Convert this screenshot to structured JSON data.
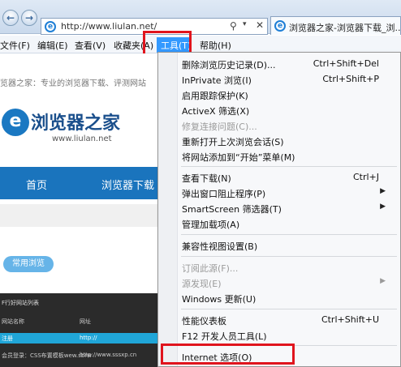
{
  "browser": {
    "address_url": "http://www.liulan.net/",
    "tab_title": "浏览器之家-浏览器下载_浏...",
    "address_icons": [
      "search-icon",
      "dropdown-icon",
      "close-icon"
    ]
  },
  "menubar": {
    "items": [
      "文件(F)",
      "编辑(E)",
      "查看(V)",
      "收藏夹(A)",
      "工具(T)",
      "帮助(H)"
    ],
    "active": "工具(T)"
  },
  "page": {
    "slogan": "览器之家：专业的浏览器下载、评测网站",
    "logo_letter": "e",
    "logo_text": "浏览器之家",
    "logo_domain": "www.liulan.net",
    "nav_home": "首页",
    "nav_download": "浏览器下载",
    "common_label": "常用浏览",
    "table_title": "F行好网站列表",
    "table_headers": [
      "网站名称",
      "网址"
    ],
    "rows": [
      [
        "注册",
        "http://"
      ],
      [
        "会员登录：CSS布置模板wew.sbrw",
        "http://www.sssxp.cn"
      ]
    ]
  },
  "tools_menu": {
    "items": [
      {
        "label": "删除浏览历史记录(D)...",
        "shortcut": "Ctrl+Shift+Del"
      },
      {
        "label": "InPrivate 浏览(I)",
        "shortcut": "Ctrl+Shift+P"
      },
      {
        "label": "启用跟踪保护(K)",
        "shortcut": ""
      },
      {
        "label": "ActiveX 筛选(X)",
        "shortcut": ""
      },
      {
        "label": "修复连接问题(C)...",
        "shortcut": "",
        "disabled": true
      },
      {
        "label": "重新打开上次浏览会话(S)",
        "shortcut": ""
      },
      {
        "label": "将网站添加到“开始”菜单(M)",
        "shortcut": ""
      },
      {
        "label": "查看下载(N)",
        "shortcut": "Ctrl+J"
      },
      {
        "label": "弹出窗口阻止程序(P)",
        "shortcut": "",
        "submenu": true
      },
      {
        "label": "SmartScreen 筛选器(T)",
        "shortcut": "",
        "submenu": true
      },
      {
        "label": "管理加载项(A)",
        "shortcut": ""
      },
      {
        "label": "兼容性视图设置(B)",
        "shortcut": ""
      },
      {
        "label": "订阅此源(F)...",
        "shortcut": "",
        "disabled": true
      },
      {
        "label": "源发现(E)",
        "shortcut": "",
        "disabled": true,
        "submenu": true
      },
      {
        "label": "Windows 更新(U)",
        "shortcut": ""
      },
      {
        "label": "性能仪表板",
        "shortcut": "Ctrl+Shift+U"
      },
      {
        "label": "F12 开发人员工具(L)",
        "shortcut": ""
      },
      {
        "label": "Internet 选项(O)",
        "shortcut": ""
      }
    ]
  },
  "colors": {
    "highlight": "#e0141d",
    "menu_active": "#3399ff",
    "nav_blue": "#1a74bd"
  }
}
